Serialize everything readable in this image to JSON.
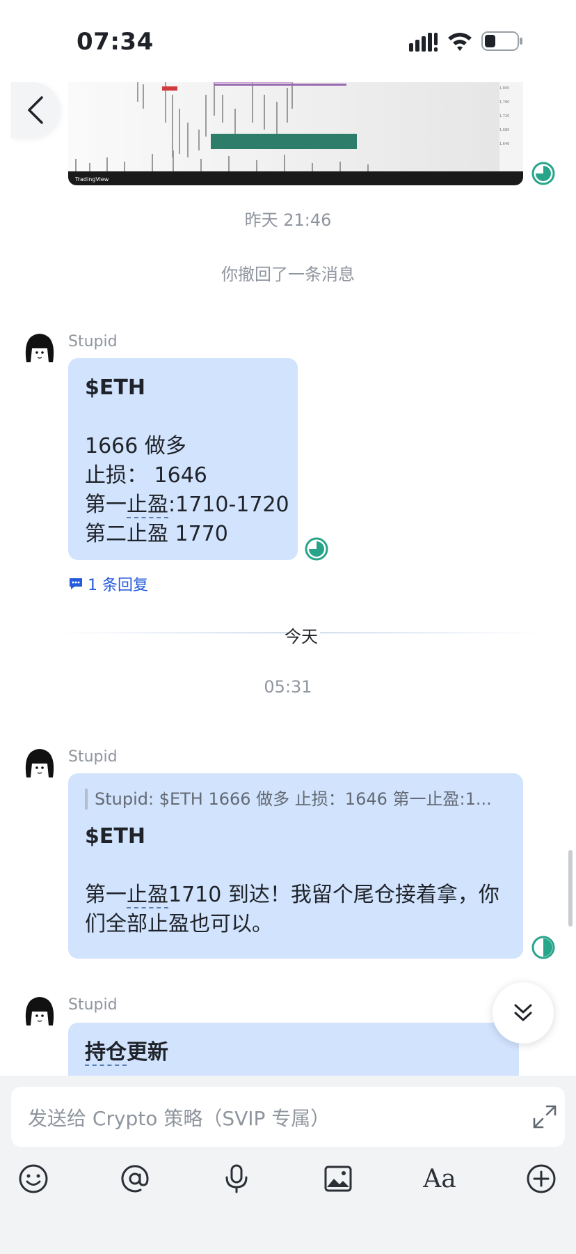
{
  "status_bar": {
    "time": "07:34",
    "battery_level": 0.35
  },
  "icons": {
    "back": "chevron-left-icon",
    "read": "read-receipt-icon",
    "reply": "message-reply-icon",
    "scroll_down": "double-chevron-down-icon",
    "expand": "expand-icon",
    "toolbar": [
      "emoji-icon",
      "mention-icon",
      "microphone-icon",
      "image-icon",
      "text-format-icon",
      "add-icon"
    ]
  },
  "chart_image": {
    "watermark": "TradingView"
  },
  "chat": {
    "time_yesterday": "昨天 21:46",
    "recall_notice": "你撤回了一条消息",
    "messages": [
      {
        "sender": "Stupid",
        "title": "$ETH",
        "lines": [
          "1666 做多",
          "止损： 1646",
          "第一",
          "止盈",
          ":1710-1720",
          "第二止盈 1770"
        ],
        "reply_count_label": "1 条回复"
      },
      {
        "sender": "Stupid",
        "quote": "Stupid: $ETH  1666 做多 止损：1646 第一止盈:1...",
        "title": "$ETH",
        "body_line1_a": "第一",
        "body_line1_b": "止盈",
        "body_line1_c": "1710 到达！我留个尾仓接着拿，你",
        "body_line2": "们全部止盈也可以。"
      },
      {
        "sender": "Stupid",
        "title_a": "持仓",
        "title_b": "更新"
      }
    ],
    "divider_label": "今天",
    "time_today": "05:31"
  },
  "composer": {
    "placeholder": "发送给 Crypto 策略（SVIP 专属）",
    "text_format_label": "Aa"
  },
  "colors": {
    "bubble": "#d1e3fd",
    "link": "#245bdb",
    "read_indicator": "#27a58a",
    "muted_text": "#8f959e"
  }
}
